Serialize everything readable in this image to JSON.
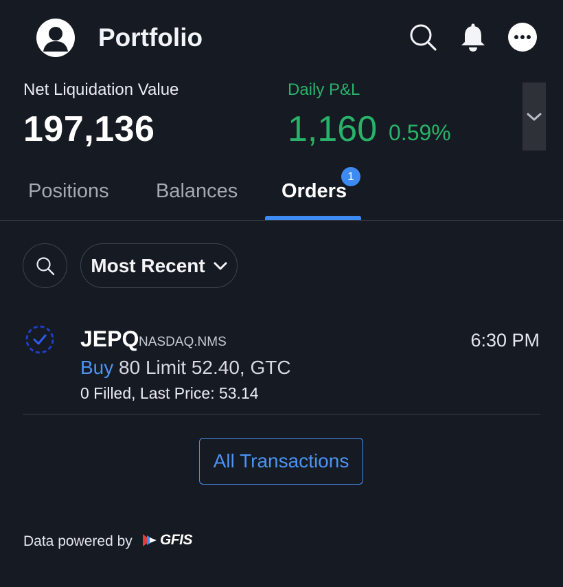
{
  "header": {
    "title": "Portfolio"
  },
  "summary": {
    "net_liquidation_label": "Net Liquidation Value",
    "net_liquidation_value": "197,136",
    "daily_pnl_label": "Daily P&L",
    "daily_pnl_value": "1,160",
    "daily_pnl_percent": "0.59%"
  },
  "tabs": [
    {
      "label": "Positions",
      "active": false
    },
    {
      "label": "Balances",
      "active": false
    },
    {
      "label": "Orders",
      "active": true,
      "badge": "1"
    }
  ],
  "filters": {
    "sort_label": "Most Recent"
  },
  "orders": [
    {
      "symbol": "JEPQ",
      "exchange": "NASDAQ.NMS",
      "time": "6:30 PM",
      "side": "Buy",
      "detail": "80 Limit 52.40, GTC",
      "fill_status": "0 Filled, Last Price: 53.14"
    }
  ],
  "actions": {
    "all_transactions_label": "All Transactions"
  },
  "footer": {
    "powered_by": "Data powered by",
    "provider_logo": "GFIS"
  },
  "colors": {
    "background": "#161a22",
    "positive": "#29b26a",
    "accent": "#3d8bf2",
    "link": "#4b93f5"
  },
  "icons": {
    "avatar": "user-avatar-icon",
    "search": "search-icon",
    "notifications": "bell-icon",
    "more": "more-options-icon",
    "expand": "chevron-down-icon",
    "order_status": "order-status-check-icon"
  }
}
